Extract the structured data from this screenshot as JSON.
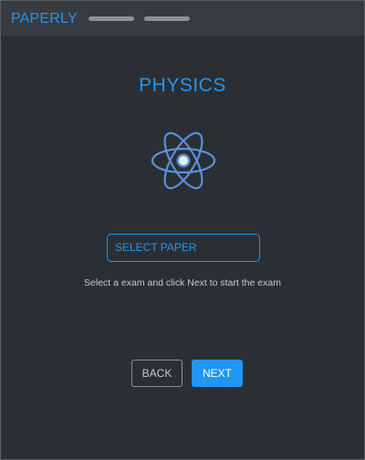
{
  "app": {
    "brand": "PAPERLY"
  },
  "main": {
    "subject_title": "PHYSICS",
    "subject_icon": "atom-icon",
    "select": {
      "label": "SELECT PAPER"
    },
    "instructions": "Select a exam and click Next to start the exam",
    "buttons": {
      "back_label": "BACK",
      "next_label": "NEXT"
    }
  },
  "colors": {
    "accent": "#2196f3",
    "background": "#2b2f33",
    "topbar": "#373c40",
    "muted_text": "#c5c8cc",
    "button_text_light": "#ffffff"
  }
}
